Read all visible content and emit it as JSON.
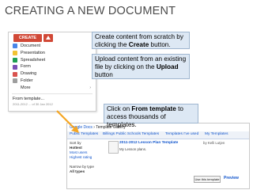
{
  "slide": {
    "title": "CREATING A NEW DOCUMENT"
  },
  "create_menu": {
    "create_label": "CREATE",
    "items": [
      "Document",
      "Presentation",
      "Spreadsheet",
      "Form",
      "Drawing",
      "Folder",
      "More"
    ],
    "more_arrow": "›",
    "from_template": "From template...",
    "footer": "2011-2012 ... of 30 Jan 2012"
  },
  "callouts": {
    "c1": {
      "pre": "Create content from scratch by clicking the ",
      "bold": "Create",
      "post": " button."
    },
    "c2": {
      "pre": "Upload content from an existing file by clicking on the ",
      "bold": "Upload",
      "post": " button"
    },
    "c3": {
      "pre": "Click on ",
      "bold": "From template",
      "post": " to access thousands of templates."
    }
  },
  "gallery": {
    "crumb_link": "Google Docs",
    "crumb_rest": " › Template Gallery",
    "tabs": [
      "Public Templates",
      "Billings Public Schools Templates",
      "Templates I've used",
      "My Templates"
    ],
    "sort_label": "Sort by",
    "sort_options": [
      "Hottest",
      "Most users",
      "Highest rating"
    ],
    "narrow_label": "Narrow by type",
    "type_options": [
      "All types"
    ],
    "card_title": "2011-2012 Lesson Plan Template",
    "card_by": "by Kelli Lutjen",
    "card_desc": "My Lesson plans.",
    "use_button": "Use this template",
    "preview": "Preview"
  },
  "colors": {
    "create_red": "#d14836",
    "callout_fill": "#dde8f4",
    "arrow": "#f5a623",
    "link": "#1155cc"
  }
}
